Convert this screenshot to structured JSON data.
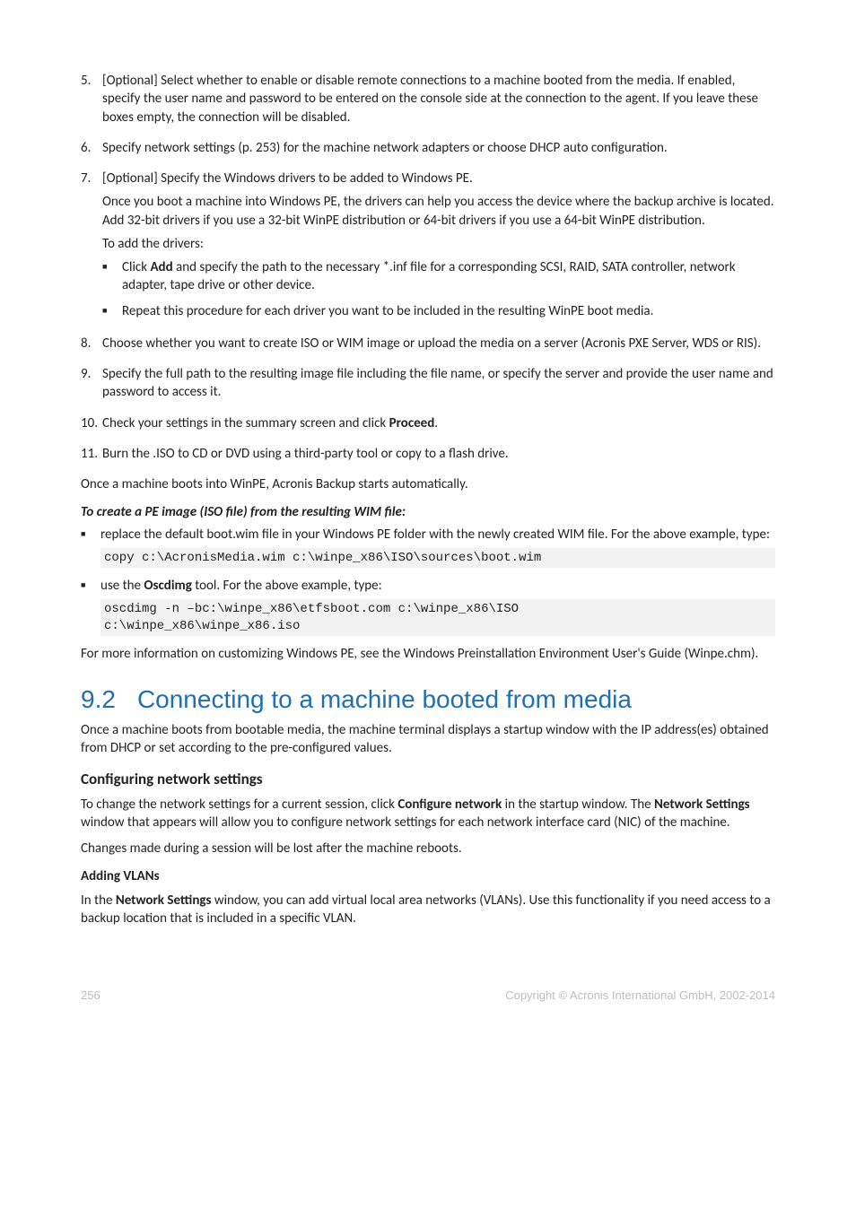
{
  "ol": {
    "i5": {
      "num": "5.",
      "text": "[Optional] Select whether to enable or disable remote connections to a machine booted from the media. If enabled, specify the user name and password to be entered on the console side at the connection to the agent. If you leave these boxes empty, the connection will be disabled."
    },
    "i6": {
      "num": "6.",
      "text": "Specify network settings (p. 253) for the machine network adapters or choose DHCP auto configuration."
    },
    "i7": {
      "num": "7.",
      "text": "[Optional] Specify the Windows drivers to be added to Windows PE.",
      "p1": "Once you boot a machine into Windows PE, the drivers can help you access the device where the backup archive is located. Add 32-bit drivers if you use a 32-bit WinPE distribution or 64-bit drivers if you use a 64-bit WinPE distribution.",
      "p2": "To add the drivers:",
      "b1a": "Click ",
      "b1bold": "Add",
      "b1b": " and specify the path to the necessary *.inf file for a corresponding SCSI, RAID, SATA controller, network adapter, tape drive or other device.",
      "b2": "Repeat this procedure for each driver you want to be included in the resulting WinPE boot media."
    },
    "i8": {
      "num": "8.",
      "text": "Choose whether you want to create ISO or WIM image or upload the media on a server (Acronis PXE Server, WDS or RIS)."
    },
    "i9": {
      "num": "9.",
      "text": "Specify the full path to the resulting image file including the file name, or specify the server and provide the user name and password to access it."
    },
    "i10": {
      "num": "10.",
      "texta": "Check your settings in the summary screen and click ",
      "bold": "Proceed",
      "textb": "."
    },
    "i11": {
      "num": "11.",
      "text": "Burn the .ISO to CD or DVD using a third-party tool or copy to a flash drive."
    }
  },
  "para_after_ol": "Once a machine boots into WinPE, Acronis Backup starts automatically.",
  "heading_pe": "To create a PE image (ISO file) from the resulting WIM file:",
  "pe_b1": "replace the default boot.wim file in your Windows PE folder with the newly created WIM file. For the above example, type:",
  "pe_code1": "copy c:\\AcronisMedia.wim c:\\winpe_x86\\ISO\\sources\\boot.wim",
  "pe_b2a": "use the ",
  "pe_b2bold": "Oscdimg",
  "pe_b2b": " tool. For the above example, type:",
  "pe_code2_l1": "oscdimg -n –bc:\\winpe_x86\\etfsboot.com c:\\winpe_x86\\ISO",
  "pe_code2_l2": "c:\\winpe_x86\\winpe_x86.iso",
  "para_pe_end": "For more information on customizing Windows PE, see the Windows Preinstallation Environment User's Guide (Winpe.chm).",
  "sec": {
    "num": "9.2",
    "title": "Connecting to a machine booted from media"
  },
  "sec_intro": "Once a machine boots from bootable media, the machine terminal displays a startup window with the IP address(es) obtained from DHCP or set according to the pre-configured values.",
  "h3_net": "Configuring network settings",
  "net_p1a": "To change the network settings for a current session, click ",
  "net_p1bold1": "Configure network",
  "net_p1b": " in the startup window. The ",
  "net_p1bold2": "Network Settings",
  "net_p1c": " window that appears will allow you to configure network settings for each network interface card (NIC) of the machine.",
  "net_p2": "Changes made during a session will be lost after the machine reboots.",
  "h4_vlan": "Adding VLANs",
  "vlan_p1a": "In the ",
  "vlan_p1bold": "Network Settings",
  "vlan_p1b": " window, you can add virtual local area networks (VLANs). Use this functionality if you need access to a backup location that is included in a specific VLAN.",
  "footer": {
    "left": "256",
    "right": "Copyright © Acronis International GmbH, 2002-2014"
  }
}
